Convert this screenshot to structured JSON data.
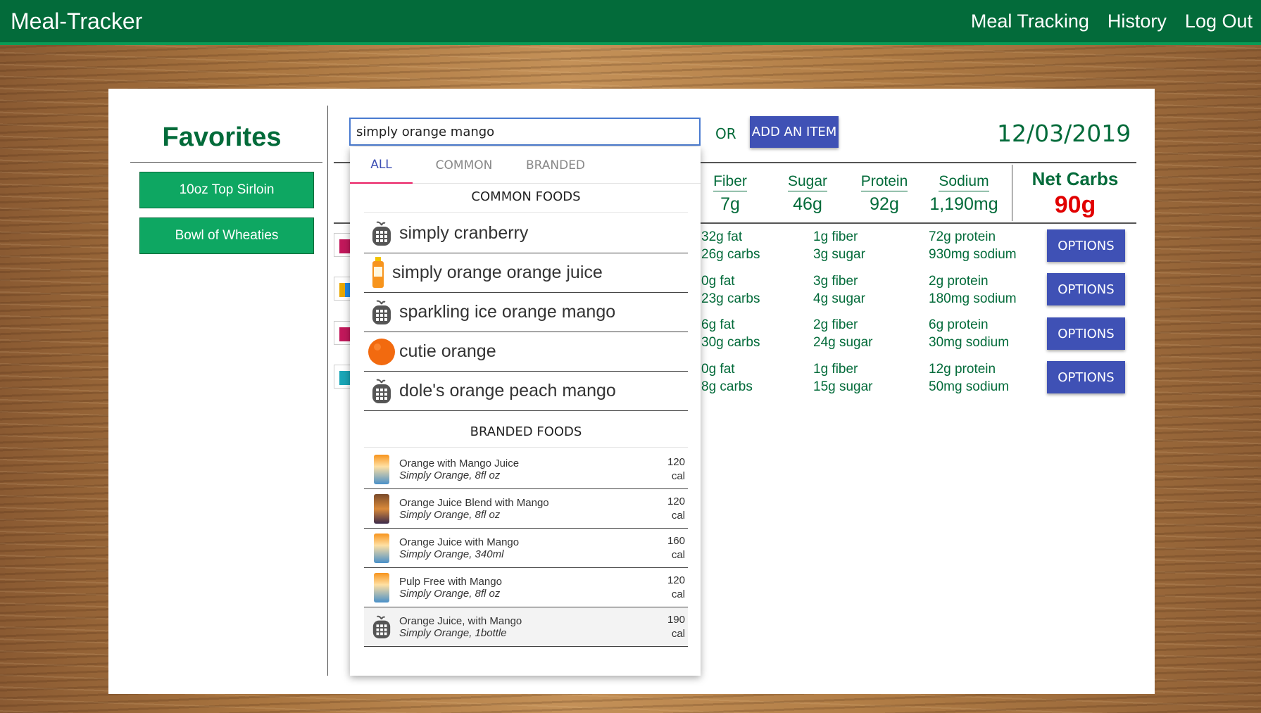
{
  "navbar": {
    "brand": "Meal-Tracker",
    "links": [
      "Meal Tracking",
      "History",
      "Log Out"
    ],
    "color": "#036b3a"
  },
  "favorites": {
    "title": "Favorites",
    "items": [
      "10oz Top Sirloin",
      "Bowl of Wheaties"
    ]
  },
  "search": {
    "value": "simply orange mango",
    "or_label": "OR",
    "add_button": "ADD AN ITEM"
  },
  "date": "12/03/2019",
  "totals": {
    "columns": [
      {
        "label": "Fiber",
        "value": "7g"
      },
      {
        "label": "Sugar",
        "value": "46g"
      },
      {
        "label": "Protein",
        "value": "92g"
      },
      {
        "label": "Sodium",
        "value": "1,190mg"
      }
    ],
    "net_carbs": {
      "label": "Net Carbs",
      "value": "90g"
    }
  },
  "meals": [
    {
      "fat": "32g fat",
      "carbs": "26g carbs",
      "fiber": "1g fiber",
      "sugar": "3g sugar",
      "protein": "72g protein",
      "sodium": "930mg sodium",
      "options": "OPTIONS",
      "color": "#c2185b"
    },
    {
      "fat": "0g fat",
      "carbs": "23g carbs",
      "fiber": "3g fiber",
      "sugar": "4g sugar",
      "protein": "2g protein",
      "sodium": "180mg sodium",
      "options": "OPTIONS",
      "color": "#e8a800"
    },
    {
      "fat": "6g fat",
      "carbs": "30g carbs",
      "fiber": "2g fiber",
      "sugar": "24g sugar",
      "protein": "6g protein",
      "sodium": "30mg sodium",
      "options": "OPTIONS",
      "color": "#c2185b"
    },
    {
      "fat": "0g fat",
      "carbs": "8g carbs",
      "fiber": "1g fiber",
      "sugar": "15g sugar",
      "protein": "12g protein",
      "sodium": "50mg sodium",
      "options": "OPTIONS",
      "color": "#1aa6b7"
    }
  ],
  "dropdown": {
    "tabs": [
      "ALL",
      "COMMON",
      "BRANDED"
    ],
    "active_tab": "ALL",
    "common_header": "COMMON FOODS",
    "common_items": [
      {
        "name": "simply cranberry",
        "icon": "generic-food-icon"
      },
      {
        "name": "simply orange orange juice",
        "icon": "juice-bottle-photo"
      },
      {
        "name": "sparkling ice orange mango",
        "icon": "generic-food-icon"
      },
      {
        "name": "cutie orange",
        "icon": "orange-photo"
      },
      {
        "name": "dole's orange peach mango",
        "icon": "generic-food-icon"
      }
    ],
    "branded_header": "BRANDED FOODS",
    "branded_items": [
      {
        "name": "Orange with Mango Juice",
        "brand": "Simply Orange, 8fl oz",
        "cal_value": "120",
        "cal_unit": "cal",
        "icon": "carton-photo"
      },
      {
        "name": "Orange Juice Blend with Mango",
        "brand": "Simply Orange, 8fl oz",
        "cal_value": "120",
        "cal_unit": "cal",
        "icon": "carton-photo"
      },
      {
        "name": "Orange Juice with Mango",
        "brand": "Simply Orange, 340ml",
        "cal_value": "160",
        "cal_unit": "cal",
        "icon": "carton-photo"
      },
      {
        "name": "Pulp Free with Mango",
        "brand": "Simply Orange, 8fl oz",
        "cal_value": "120",
        "cal_unit": "cal",
        "icon": "carton-photo"
      },
      {
        "name": "Orange Juice, with Mango",
        "brand": "Simply Orange, 1bottle",
        "cal_value": "190",
        "cal_unit": "cal",
        "icon": "generic-food-icon"
      }
    ]
  }
}
